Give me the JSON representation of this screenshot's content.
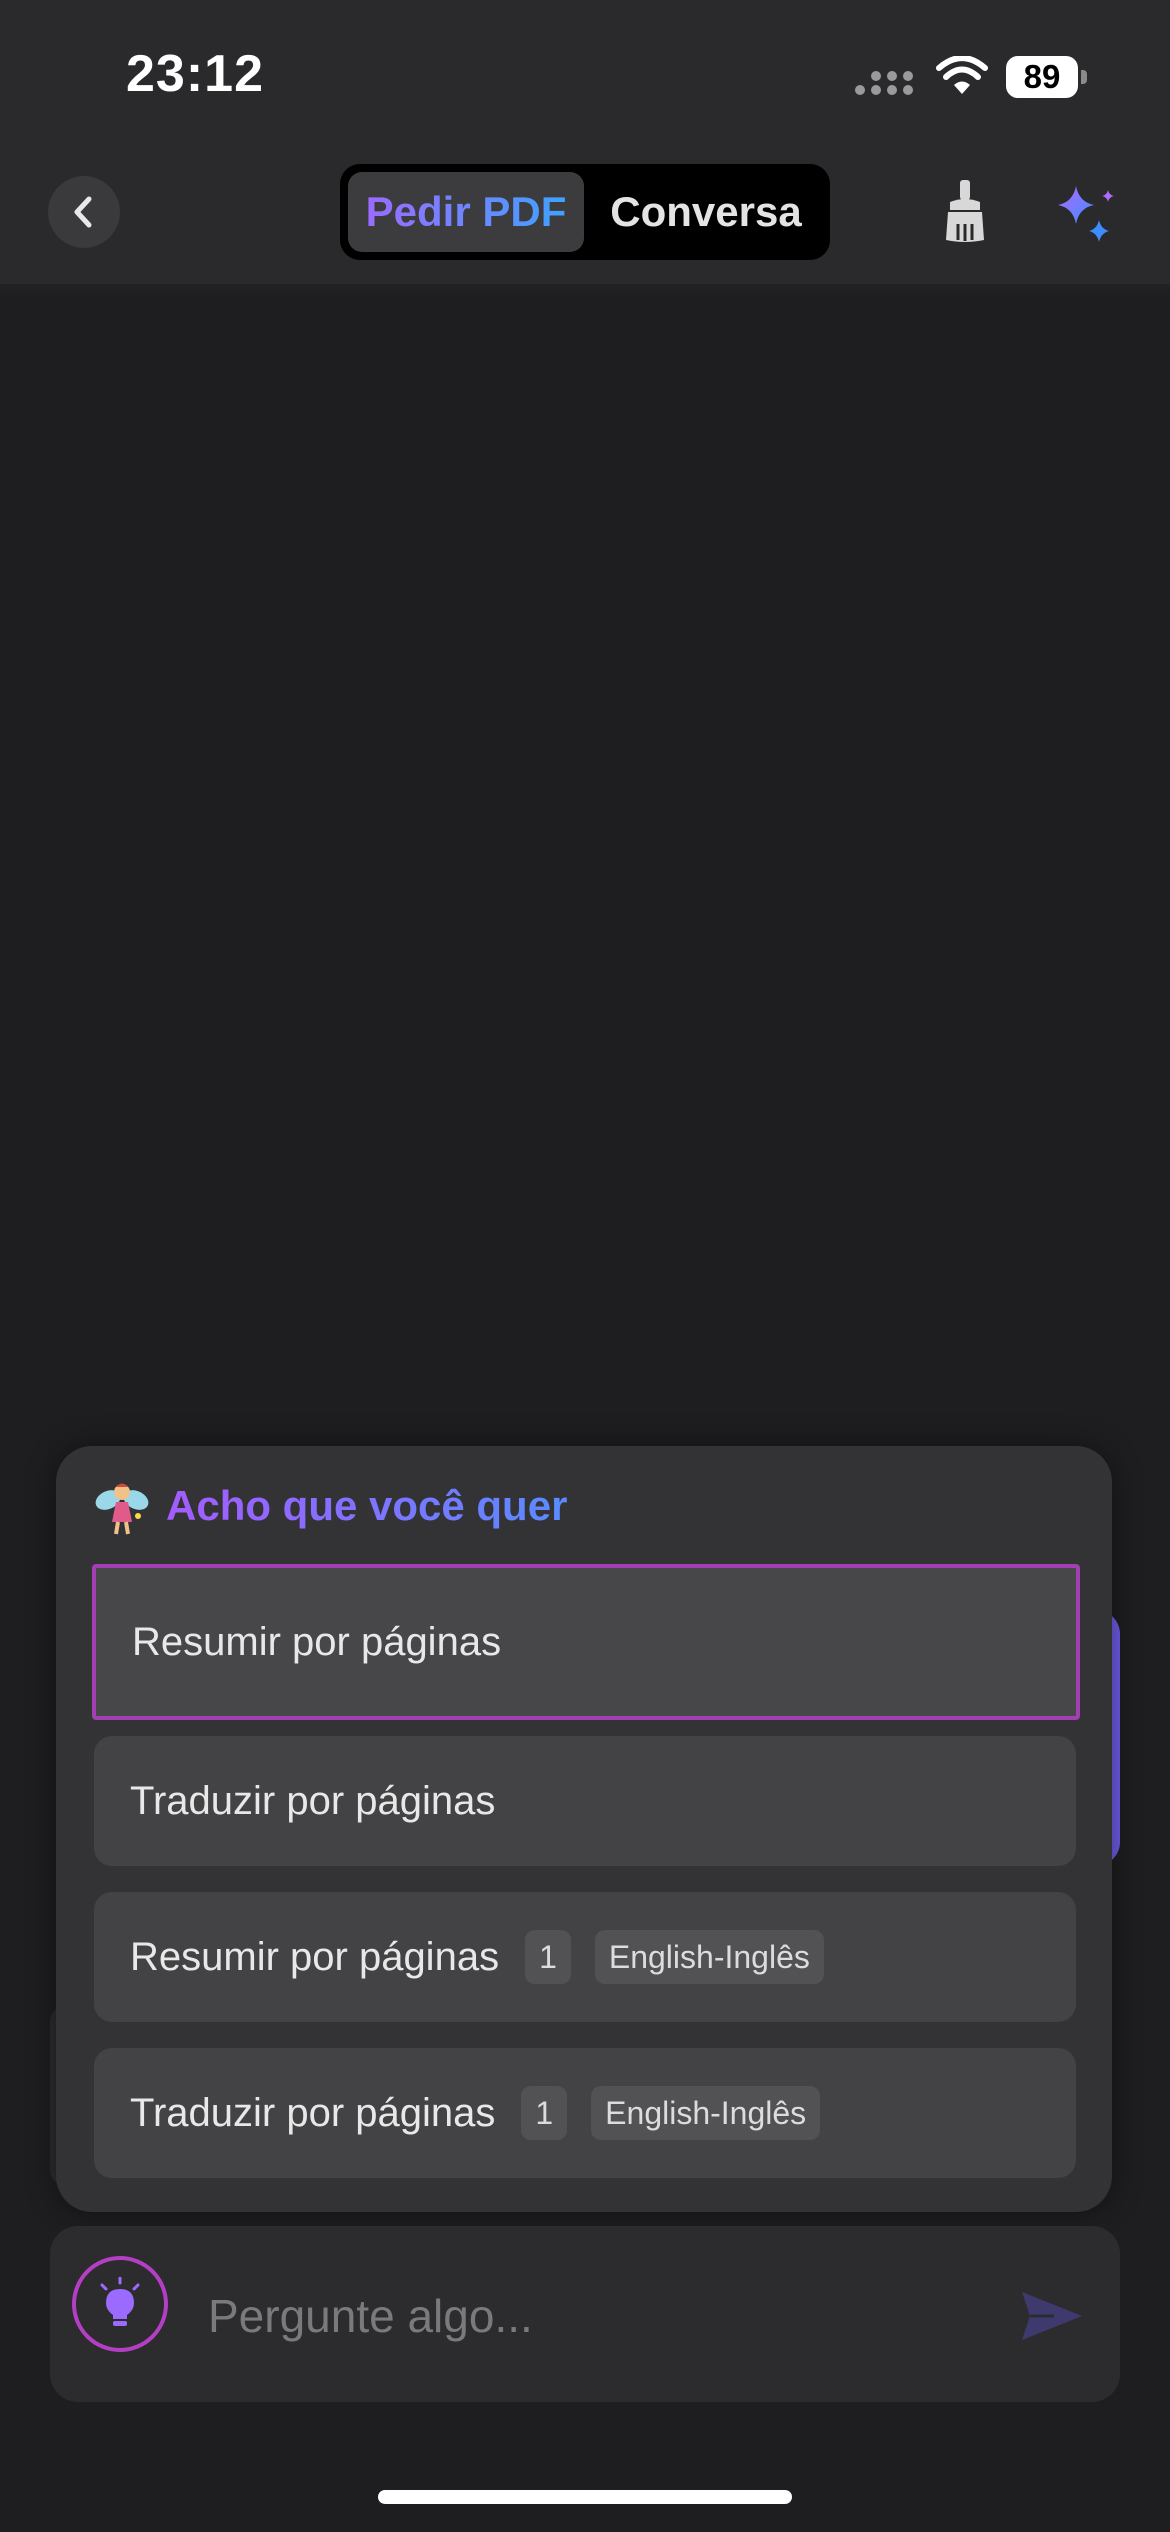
{
  "status_bar": {
    "time": "23:12",
    "battery": "89",
    "icons": [
      "signal-icon",
      "wifi-icon",
      "battery-icon"
    ]
  },
  "header": {
    "back_icon": "chevron-left-icon",
    "tabs": [
      {
        "label": "Pedir PDF",
        "active": true
      },
      {
        "label": "Conversa",
        "active": false
      }
    ],
    "action_icons": [
      "broom-icon",
      "sparkle-icon"
    ]
  },
  "suggestions": {
    "title": "Acho que você quer",
    "title_icon": "fairy-icon",
    "items": [
      {
        "label": "Resumir por páginas",
        "page": "",
        "language": "",
        "selected": true
      },
      {
        "label": "Traduzir por páginas",
        "page": "",
        "language": "",
        "selected": false
      },
      {
        "label": "Resumir por páginas",
        "page": "1",
        "language": "English-Inglês",
        "selected": false
      },
      {
        "label": "Traduzir por páginas",
        "page": "1",
        "language": "English-Inglês",
        "selected": false
      }
    ]
  },
  "input_bar": {
    "placeholder": "Pergunte algo...",
    "left_icon": "lightbulb-icon",
    "send_icon": "send-icon"
  },
  "colors": {
    "accent_purple": "#9b6bff",
    "accent_blue": "#3fa2ff",
    "selection_border": "#a13fb3",
    "background": "#1e1e20",
    "header": "#2a2a2c",
    "panel": "#333335"
  }
}
